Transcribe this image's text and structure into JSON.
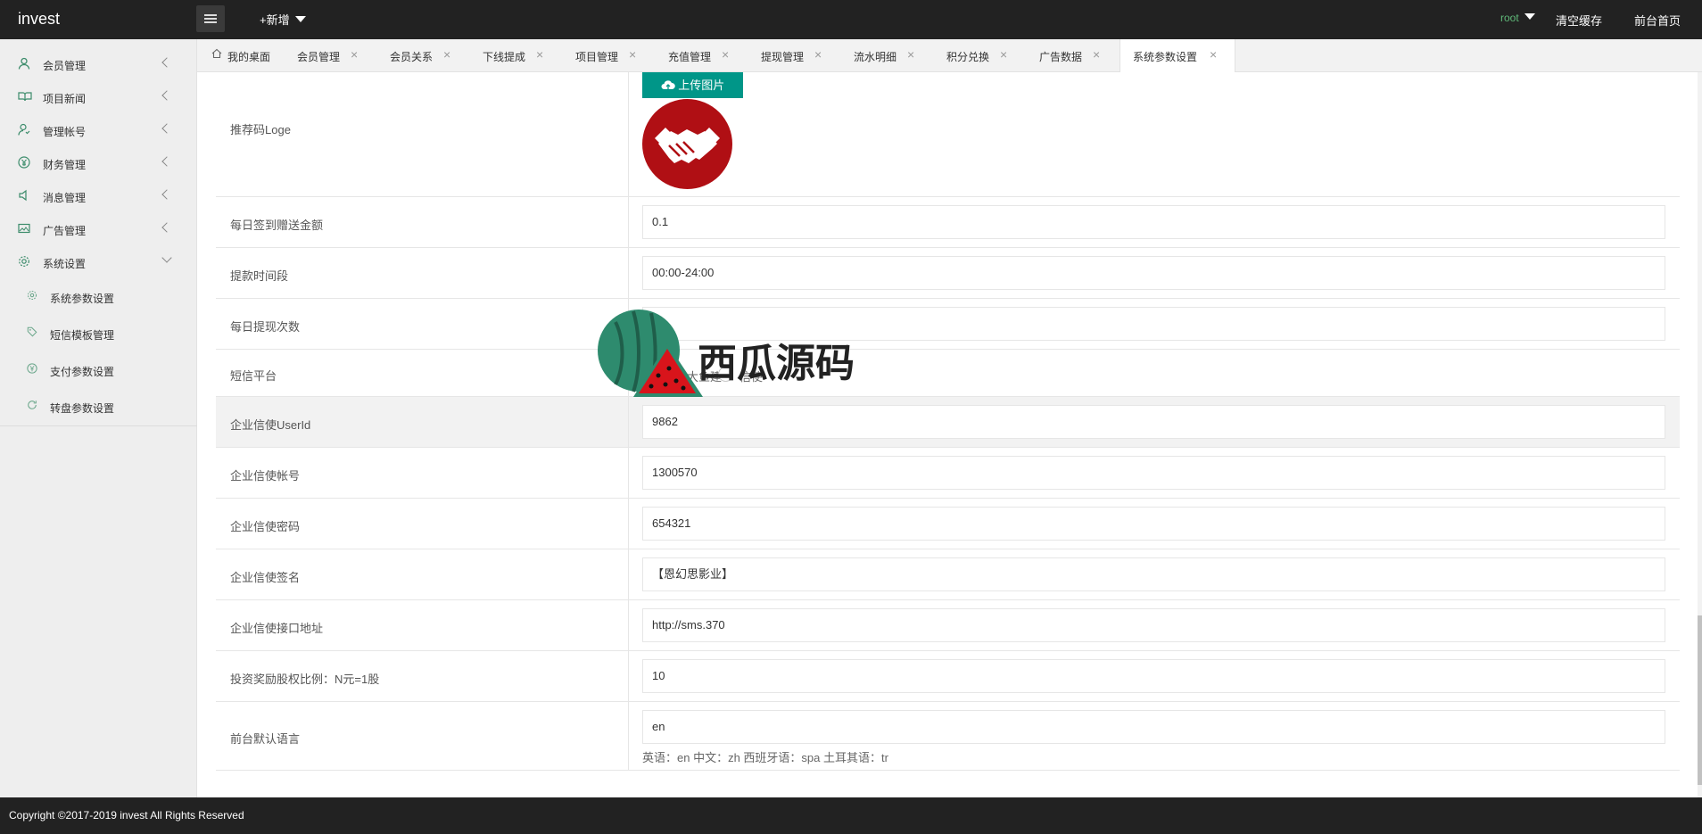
{
  "app": {
    "title": "invest"
  },
  "header": {
    "new_label": "+新增",
    "user": "root",
    "clear_cache": "清空缓存",
    "front_home": "前台首页"
  },
  "sidebar": {
    "items": [
      {
        "label": "会员管理",
        "icon": "user-icon"
      },
      {
        "label": "项目新闻",
        "icon": "book-icon"
      },
      {
        "label": "管理帐号",
        "icon": "account-icon"
      },
      {
        "label": "财务管理",
        "icon": "yen-icon"
      },
      {
        "label": "消息管理",
        "icon": "speaker-icon"
      },
      {
        "label": "广告管理",
        "icon": "image-icon"
      },
      {
        "label": "系统设置",
        "icon": "gear-icon",
        "expanded": true
      }
    ],
    "subitems": [
      {
        "label": "系统参数设置",
        "icon": "gear-icon"
      },
      {
        "label": "短信模板管理",
        "icon": "tag-icon"
      },
      {
        "label": "支付参数设置",
        "icon": "yen-icon"
      },
      {
        "label": "转盘参数设置",
        "icon": "refresh-icon"
      }
    ]
  },
  "tabs": [
    {
      "label": "我的桌面"
    },
    {
      "label": "会员管理"
    },
    {
      "label": "会员关系"
    },
    {
      "label": "下线提成"
    },
    {
      "label": "项目管理"
    },
    {
      "label": "充值管理"
    },
    {
      "label": "提现管理"
    },
    {
      "label": "流水明细"
    },
    {
      "label": "积分兑换"
    },
    {
      "label": "广告数据"
    },
    {
      "label": "系统参数设置",
      "active": true
    }
  ],
  "form": {
    "logo_row": {
      "label": "推荐码Loge",
      "upload_label": "上传图片"
    },
    "rows": [
      {
        "label": "每日签到赠送金额",
        "value": "0.1"
      },
      {
        "label": "提款时间段",
        "value": "00:00-24:00"
      },
      {
        "label": "每日提现次数",
        "value": ""
      }
    ],
    "sms": {
      "label": "短信平台",
      "option1": "阿里大鱼建",
      "option2": "信使"
    },
    "rows2": [
      {
        "label": "企业信使UserId",
        "value": "9862"
      },
      {
        "label": "企业信使帐号",
        "value": "1300570"
      },
      {
        "label": "企业信使密码",
        "value": "654321"
      },
      {
        "label": "企业信使签名",
        "value": "【恩幻思影业】"
      },
      {
        "label": "企业信使接口地址",
        "value": "http://sms.370"
      },
      {
        "label": "投资奖励股权比例：N元=1股",
        "value": "10"
      }
    ],
    "lang": {
      "label": "前台默认语言",
      "value": "en",
      "hint": "英语：en 中文：zh 西班牙语：spa 土耳其语：tr"
    }
  },
  "watermark": {
    "text": "西瓜源码"
  },
  "footer": {
    "copyright": "Copyright ©2017-2019 invest All Rights Reserved"
  },
  "colors": {
    "topbar": "#222222",
    "accent": "#009688",
    "user": "#5FB878",
    "logo_red": "#b00f14"
  }
}
